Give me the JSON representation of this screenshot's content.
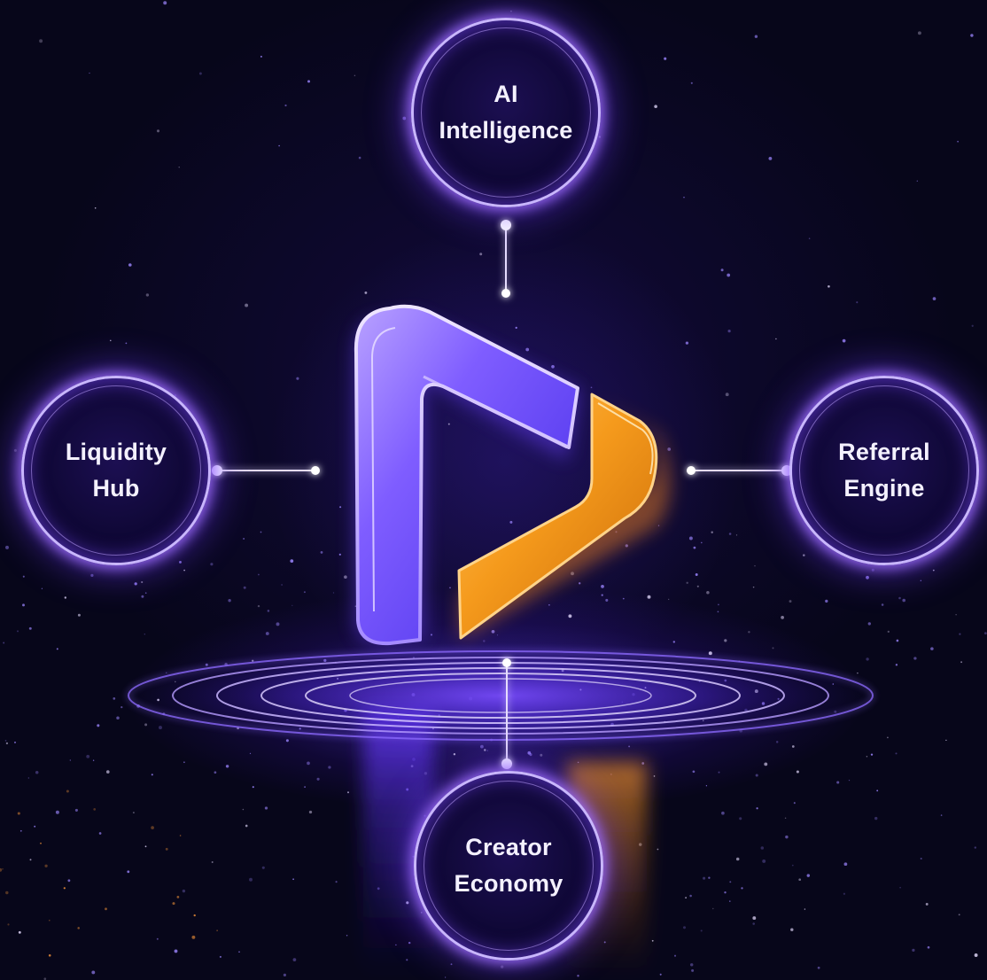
{
  "diagram": {
    "nodes": [
      {
        "id": "ai",
        "lines": [
          "AI",
          "Intelligence"
        ]
      },
      {
        "id": "liquidity",
        "lines": [
          "Liquidity",
          "Hub"
        ]
      },
      {
        "id": "referral",
        "lines": [
          "Referral",
          "Engine"
        ]
      },
      {
        "id": "creator",
        "lines": [
          "Creator",
          "Economy"
        ]
      }
    ],
    "center_logo": "play-logo-icon",
    "colors": {
      "background": "#07061a",
      "ring_glow": "#8f5cff",
      "ring_border": "#c9b6ff",
      "logo_purple": "#7a5cff",
      "logo_orange": "#f59a1c",
      "connector": "#e6dcff"
    }
  }
}
